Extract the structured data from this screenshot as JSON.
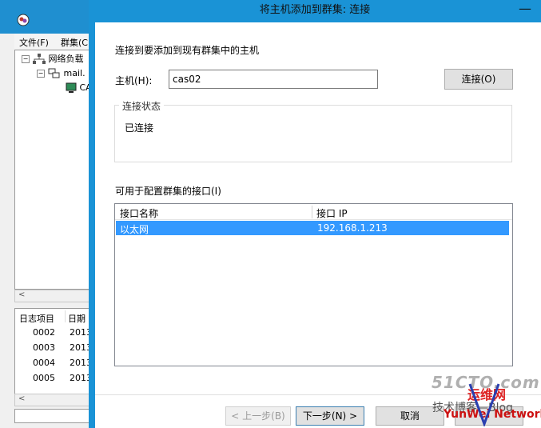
{
  "background_window": {
    "menu": [
      "文件(F)",
      "群集(C"
    ],
    "tree": {
      "root_label": "网络负载",
      "child_label": "mail.",
      "grandchild_label": "CA"
    },
    "log": {
      "headers": [
        "日志项目",
        "日期"
      ],
      "rows": [
        [
          "0002",
          "2013"
        ],
        [
          "0003",
          "2013"
        ],
        [
          "0004",
          "2013"
        ],
        [
          "0005",
          "2013"
        ]
      ]
    }
  },
  "dialog": {
    "title": "将主机添加到群集: 连接",
    "instruction": "连接到要添加到现有群集中的主机",
    "host_label": "主机(H):",
    "host_value": "cas02",
    "connect_label": "连接(O)",
    "status_legend": "连接状态",
    "status_text": "已连接",
    "interfaces_label": "可用于配置群集的接口(I)",
    "columns": [
      "接口名称",
      "接口 IP"
    ],
    "interfaces": [
      {
        "name": "以太网",
        "ip": "192.168.1.213"
      }
    ],
    "buttons": {
      "back": "< 上一步(B)",
      "next": "下一步(N) >",
      "cancel": "取消"
    }
  },
  "watermark": {
    "site": "51CTO.com",
    "blog": "技术博客—Blog",
    "brand": "运维网",
    "network": "YunWei Network"
  },
  "colors": {
    "titlebar": "#1a93d6",
    "selection": "#3399ff"
  }
}
